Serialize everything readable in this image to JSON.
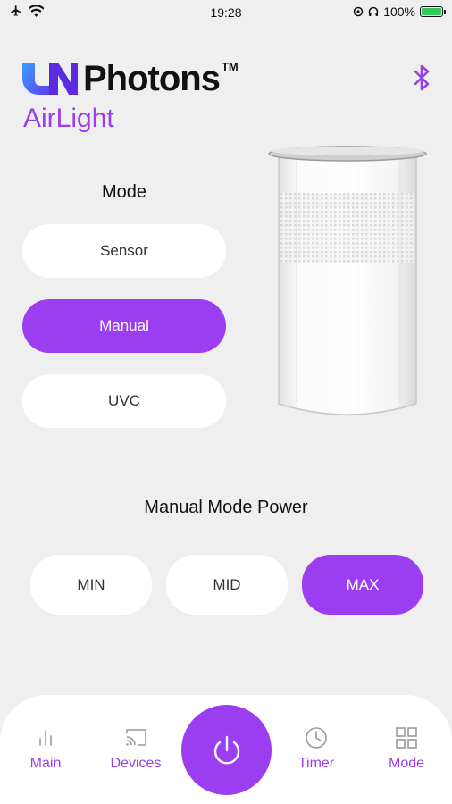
{
  "status_bar": {
    "time": "19:28",
    "battery_percent": "100%",
    "battery_level": 1.0
  },
  "brand": {
    "name": "Photons",
    "trademark": "TM",
    "product": "AirLight"
  },
  "mode": {
    "title": "Mode",
    "options": [
      {
        "label": "Sensor",
        "active": false
      },
      {
        "label": "Manual",
        "active": true
      },
      {
        "label": "UVC",
        "active": false
      }
    ]
  },
  "power": {
    "title": "Manual Mode Power",
    "options": [
      {
        "label": "MIN",
        "active": false
      },
      {
        "label": "MID",
        "active": false
      },
      {
        "label": "MAX",
        "active": true
      }
    ]
  },
  "tabs": {
    "main": "Main",
    "devices": "Devices",
    "timer": "Timer",
    "mode": "Mode"
  },
  "icons": {
    "airplane": "airplane-icon",
    "wifi": "wifi-icon",
    "bluetooth": "bluetooth-icon",
    "power": "power-icon",
    "main": "bar-chart-icon",
    "devices": "cast-icon",
    "timer": "clock-icon",
    "mode": "grid-icon"
  },
  "colors": {
    "accent": "#9b3df0",
    "background": "#efeff0",
    "battery": "#34c759"
  }
}
